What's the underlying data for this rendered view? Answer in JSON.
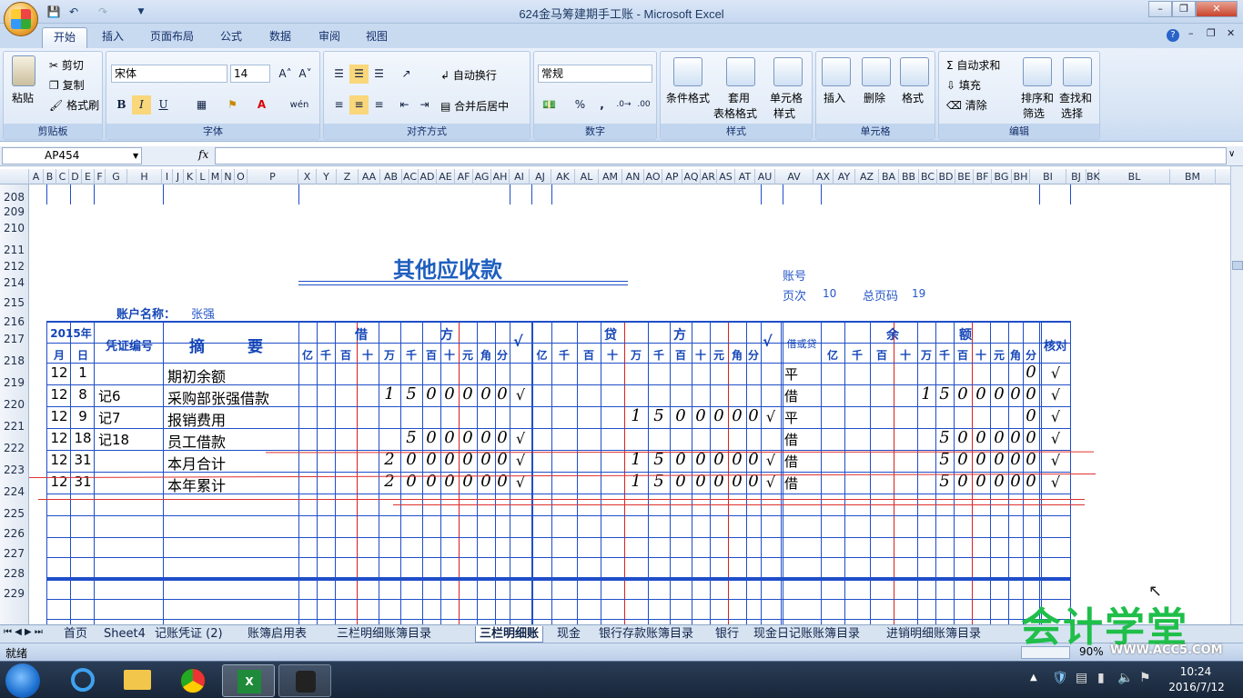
{
  "window": {
    "title": "624金马筹建期手工账 - Microsoft Excel",
    "app_icon": "office-button-icon"
  },
  "quick_access": [
    "save-icon",
    "undo-icon",
    "redo-icon"
  ],
  "ribbon_tabs": [
    "开始",
    "插入",
    "页面布局",
    "公式",
    "数据",
    "审阅",
    "视图"
  ],
  "ribbon": {
    "clipboard": {
      "label": "剪贴板",
      "paste": "粘贴",
      "cut": "剪切",
      "copy": "复制",
      "format_painter": "格式刷"
    },
    "font": {
      "label": "字体",
      "font_name": "宋体",
      "font_size": "14",
      "bold": "B",
      "italic": "I",
      "underline": "U",
      "phonetic": "wén"
    },
    "alignment": {
      "label": "对齐方式",
      "wrap": "自动换行",
      "merge": "合并后居中"
    },
    "number": {
      "label": "数字",
      "format": "常规",
      "percent": "%",
      "comma": ","
    },
    "styles": {
      "label": "样式",
      "conditional": "条件格式",
      "table_style1": "套用",
      "table_style2": "表格格式",
      "cell_style1": "单元格",
      "cell_style2": "样式"
    },
    "cells": {
      "label": "单元格",
      "insert": "插入",
      "delete": "删除",
      "format": "格式"
    },
    "editing": {
      "label": "编辑",
      "autosum": "自动求和",
      "fill": "填充",
      "clear": "清除",
      "sort1": "排序和",
      "sort2": "筛选",
      "find1": "查找和",
      "find2": "选择"
    }
  },
  "formula_bar": {
    "name_box": "AP454",
    "fx": "fx",
    "value": ""
  },
  "columns": [
    "A",
    "B",
    "C",
    "D",
    "E",
    "F",
    "G",
    "H",
    "I",
    "J",
    "K",
    "L",
    "M",
    "N",
    "O",
    "P",
    "X",
    "Y",
    "Z",
    "AA",
    "AB",
    "AC",
    "AD",
    "AE",
    "AF",
    "AG",
    "AH",
    "AI",
    "AJ",
    "AK",
    "AL",
    "AM",
    "AN",
    "AO",
    "AP",
    "AQ",
    "AR",
    "AS",
    "AT",
    "AU",
    "AV",
    "AX",
    "AY",
    "AZ",
    "BA",
    "BB",
    "BC",
    "BD",
    "BE",
    "BF",
    "BG",
    "BH",
    "BI",
    "BJ",
    "BK",
    "BL",
    "BM"
  ],
  "rows": [
    "208",
    "209",
    "210",
    "211",
    "212",
    "214",
    "215",
    "216",
    "217",
    "218",
    "219",
    "220",
    "221",
    "222",
    "223",
    "224",
    "225",
    "226",
    "227",
    "228",
    "229"
  ],
  "ledger": {
    "title": "其他应收款",
    "account_no_label": "账号",
    "page_label": "页次",
    "page": "10",
    "total_page_label": "总页码",
    "total_page": "19",
    "account_name_label": "账户名称：",
    "account_name": "张强",
    "year": "2015年",
    "month": "月",
    "day": "日",
    "voucher_no": "凭证编号",
    "summary1": "摘",
    "summary2": "要",
    "debit1": "借",
    "debit2": "方",
    "credit1": "贷",
    "credit2": "方",
    "check": "√",
    "dr_cr": "借或贷",
    "balance1": "余",
    "balance2": "额",
    "verify": "核对",
    "units": [
      "亿",
      "千",
      "百",
      "十",
      "万",
      "千",
      "百",
      "十",
      "元",
      "角",
      "分"
    ],
    "entries": [
      {
        "m": "12",
        "d": "1",
        "v": "",
        "s": "期初余额",
        "debit": "",
        "dchk": "",
        "credit": "",
        "cchk": "",
        "dc": "平",
        "bal": "0",
        "vf": "√"
      },
      {
        "m": "12",
        "d": "8",
        "v": "记6",
        "s": "采购部张强借款",
        "debit": "1500000",
        "dchk": "√",
        "credit": "",
        "cchk": "",
        "dc": "借",
        "bal": "1500000",
        "vf": "√"
      },
      {
        "m": "12",
        "d": "9",
        "v": "记7",
        "s": "报销费用",
        "debit": "",
        "dchk": "",
        "credit": "1500000",
        "cchk": "√",
        "dc": "平",
        "bal": "0",
        "vf": "√"
      },
      {
        "m": "12",
        "d": "18",
        "v": "记18",
        "s": "员工借款",
        "debit": "500000",
        "dchk": "√",
        "credit": "",
        "cchk": "",
        "dc": "借",
        "bal": "500000",
        "vf": "√"
      },
      {
        "m": "12",
        "d": "31",
        "v": "",
        "s": "本月合计",
        "debit": "2000000",
        "dchk": "√",
        "credit": "1500000",
        "cchk": "√",
        "dc": "借",
        "bal": "500000",
        "vf": "√"
      },
      {
        "m": "12",
        "d": "31",
        "v": "",
        "s": "本年累计",
        "debit": "2000000",
        "dchk": "√",
        "credit": "1500000",
        "cchk": "√",
        "dc": "借",
        "bal": "500000",
        "vf": "√"
      }
    ]
  },
  "sheet_tabs": [
    "首页",
    "Sheet4",
    "记账凭证 (2)",
    "账簿启用表",
    "三栏明细账簿目录",
    "三栏明细账",
    "现金",
    "银行存款账簿目录",
    "银行",
    "现金日记账账簿目录",
    "进销明细账簿目录"
  ],
  "active_sheet": "三栏明细账",
  "status": {
    "ready": "就绪",
    "zoom": "90%"
  },
  "taskbar": {
    "time": "10:24",
    "date": "2016/7/12"
  },
  "watermark": {
    "brand": "会计学堂",
    "url": "WWW.ACC5.COM"
  },
  "colors": {
    "grid_blue": "#1f4ec9",
    "red_line": "#dd1f1f",
    "title_blue": "#1f5fbf"
  }
}
